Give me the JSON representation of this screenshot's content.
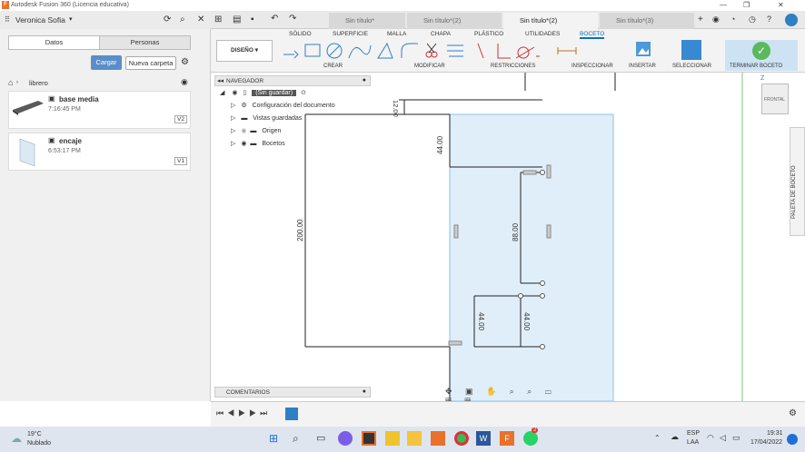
{
  "app": {
    "title": "Autodesk Fusion 360 (Licencia educativa)"
  },
  "user": {
    "name": "Veronica Sofia"
  },
  "data_panel": {
    "tab_data": "Datos",
    "tab_people": "Personas",
    "upload": "Cargar",
    "new_folder": "Nueva carpeta",
    "folder": "librero",
    "items": [
      {
        "name": "base media",
        "time": "7:16:45 PM",
        "version": "V2"
      },
      {
        "name": "encaje",
        "time": "6:53:17 PM",
        "version": "V1"
      }
    ]
  },
  "doc_tabs": [
    "Sin título*",
    "Sin título*(2)",
    "Sin título*(2)",
    "Sin título*(3)"
  ],
  "ribbon": {
    "tabs": [
      "SÓLIDO",
      "SUPERFICIE",
      "MALLA",
      "CHAPA",
      "PLÁSTICO",
      "UTILIDADES",
      "BOCETO"
    ],
    "design": "DISEÑO",
    "groups": [
      "CREAR",
      "MODIFICAR",
      "RESTRICCIONES",
      "INSPECCIONAR",
      "INSERTAR",
      "SELECCIONAR",
      "TERMINAR BOCETO"
    ]
  },
  "browser": {
    "title": "NAVEGADOR",
    "root": "(Sin guardar)",
    "rows": [
      "Configuración del documento",
      "Vistas guardadas",
      "Origen",
      "Bocetos"
    ]
  },
  "comments": "COMENTARIOS",
  "viewcube": {
    "face": "FRONTAL",
    "axis": "Z"
  },
  "palette": "PALETA DE BOCETO",
  "dims": [
    "12.00",
    "44.00",
    "200.00",
    "88.00",
    "44.00",
    "44.00"
  ],
  "weather": {
    "temp": "19°C",
    "cond": "Nublado"
  },
  "tray": {
    "lang1": "ESP",
    "lang2": "LAA",
    "time": "19:31",
    "date": "17/04/2022",
    "badge": "2"
  }
}
